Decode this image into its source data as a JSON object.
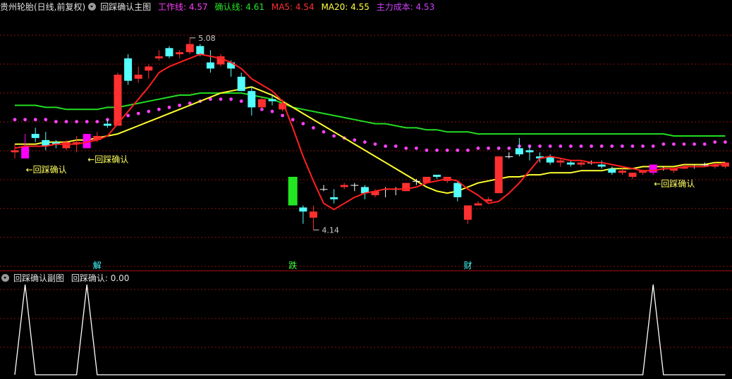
{
  "main_header": {
    "stock_title": "贵州轮胎(日线,前复权)",
    "indicator_name": "回踩确认主图",
    "legend": [
      {
        "label": "工作线: 4.57",
        "color": "#ff3cff"
      },
      {
        "label": "确认线: 4.61",
        "color": "#22e622"
      },
      {
        "label": "MA5: 4.54",
        "color": "#ff3030"
      },
      {
        "label": "MA20: 4.55",
        "color": "#ffff40"
      },
      {
        "label": "主力成本: 4.53",
        "color": "#d040ff"
      }
    ]
  },
  "sub_header": {
    "indicator_name": "回踩确认副图",
    "value_text": "回踩确认: 0.00"
  },
  "annotations": {
    "high_label": "5.08",
    "low_label": "4.14",
    "signal_label": "←回踩确认",
    "events": [
      {
        "text": "解",
        "color": "#40ffff"
      },
      {
        "text": "跌",
        "color": "#40ff40"
      },
      {
        "text": "财",
        "color": "#40ffff"
      }
    ]
  },
  "colors": {
    "background": "#000000",
    "grid": "#8b1010",
    "up_candle": "#ff3030",
    "down_candle": "#54ffff",
    "doji": "#ffffff",
    "signal_candle": "#ff00ff",
    "limit_down_candle": "#22e622",
    "ma5": "#ff2020",
    "ma20": "#ffff30",
    "confirm_line": "#22dd22",
    "work_line": "#ff40ff",
    "sub_line": "#ffffff",
    "label_white": "#cccccc",
    "label_yellow": "#ffff60"
  },
  "chart_data": [
    {
      "type": "candlestick",
      "title": "回踩确认主图",
      "ylim": [
        4.0,
        5.2
      ],
      "candles": [
        {
          "o": 4.52,
          "h": 4.56,
          "l": 4.49,
          "c": 4.53
        },
        {
          "o": 4.55,
          "h": 4.61,
          "l": 4.49,
          "c": 4.49,
          "signal": true
        },
        {
          "o": 4.61,
          "h": 4.64,
          "l": 4.57,
          "c": 4.59
        },
        {
          "o": 4.58,
          "h": 4.62,
          "l": 4.53,
          "c": 4.55
        },
        {
          "o": 4.57,
          "h": 4.58,
          "l": 4.54,
          "c": 4.56
        },
        {
          "o": 4.54,
          "h": 4.58,
          "l": 4.53,
          "c": 4.57
        },
        {
          "o": 4.56,
          "h": 4.6,
          "l": 4.52,
          "c": 4.57
        },
        {
          "o": 4.54,
          "h": 4.61,
          "l": 4.54,
          "c": 4.61,
          "signal": true
        },
        {
          "o": 4.58,
          "h": 4.62,
          "l": 4.57,
          "c": 4.6
        },
        {
          "o": 4.66,
          "h": 4.68,
          "l": 4.64,
          "c": 4.65
        },
        {
          "o": 4.65,
          "h": 4.91,
          "l": 4.65,
          "c": 4.9
        },
        {
          "o": 4.98,
          "h": 5.0,
          "l": 4.85,
          "c": 4.87
        },
        {
          "o": 4.88,
          "h": 4.94,
          "l": 4.86,
          "c": 4.9
        },
        {
          "o": 4.92,
          "h": 4.95,
          "l": 4.88,
          "c": 4.94
        },
        {
          "o": 4.98,
          "h": 5.02,
          "l": 4.97,
          "c": 4.99
        },
        {
          "o": 5.03,
          "h": 5.04,
          "l": 4.98,
          "c": 4.99
        },
        {
          "o": 5.0,
          "h": 5.02,
          "l": 4.98,
          "c": 5.01
        },
        {
          "o": 5.01,
          "h": 5.08,
          "l": 5.0,
          "c": 5.05
        },
        {
          "o": 5.04,
          "h": 5.05,
          "l": 4.99,
          "c": 5.0
        },
        {
          "o": 4.96,
          "h": 5.02,
          "l": 4.91,
          "c": 4.93
        },
        {
          "o": 4.95,
          "h": 5.0,
          "l": 4.94,
          "c": 4.99
        },
        {
          "o": 4.96,
          "h": 4.97,
          "l": 4.89,
          "c": 4.93
        },
        {
          "o": 4.89,
          "h": 4.91,
          "l": 4.82,
          "c": 4.82
        },
        {
          "o": 4.82,
          "h": 4.84,
          "l": 4.7,
          "c": 4.74
        },
        {
          "o": 4.74,
          "h": 4.79,
          "l": 4.73,
          "c": 4.78
        },
        {
          "o": 4.78,
          "h": 4.8,
          "l": 4.75,
          "c": 4.77
        },
        {
          "o": 4.73,
          "h": 4.78,
          "l": 4.72,
          "c": 4.76
        },
        {
          "o": 4.4,
          "h": 4.4,
          "l": 4.26,
          "c": 4.26,
          "limit": true
        },
        {
          "o": 4.25,
          "h": 4.26,
          "l": 4.17,
          "c": 4.23
        },
        {
          "o": 4.2,
          "h": 4.26,
          "l": 4.14,
          "c": 4.23
        },
        {
          "o": 4.34,
          "h": 4.36,
          "l": 4.33,
          "c": 4.34
        },
        {
          "o": 4.3,
          "h": 4.34,
          "l": 4.27,
          "c": 4.29
        },
        {
          "o": 4.35,
          "h": 4.37,
          "l": 4.34,
          "c": 4.36
        },
        {
          "o": 4.36,
          "h": 4.37,
          "l": 4.33,
          "c": 4.36
        },
        {
          "o": 4.35,
          "h": 4.36,
          "l": 4.29,
          "c": 4.32
        },
        {
          "o": 4.31,
          "h": 4.34,
          "l": 4.3,
          "c": 4.33
        },
        {
          "o": 4.34,
          "h": 4.35,
          "l": 4.3,
          "c": 4.34
        },
        {
          "o": 4.34,
          "h": 4.35,
          "l": 4.31,
          "c": 4.34
        },
        {
          "o": 4.33,
          "h": 4.37,
          "l": 4.33,
          "c": 4.37
        },
        {
          "o": 4.38,
          "h": 4.39,
          "l": 4.36,
          "c": 4.38
        },
        {
          "o": 4.37,
          "h": 4.4,
          "l": 4.37,
          "c": 4.4
        },
        {
          "o": 4.41,
          "h": 4.41,
          "l": 4.39,
          "c": 4.4
        },
        {
          "o": 4.38,
          "h": 4.4,
          "l": 4.37,
          "c": 4.4
        },
        {
          "o": 4.37,
          "h": 4.38,
          "l": 4.28,
          "c": 4.3
        },
        {
          "o": 4.19,
          "h": 4.26,
          "l": 4.17,
          "c": 4.26
        },
        {
          "o": 4.26,
          "h": 4.28,
          "l": 4.26,
          "c": 4.27
        },
        {
          "o": 4.28,
          "h": 4.3,
          "l": 4.28,
          "c": 4.29
        },
        {
          "o": 4.32,
          "h": 4.5,
          "l": 4.32,
          "c": 4.5
        },
        {
          "o": 4.5,
          "h": 4.52,
          "l": 4.49,
          "c": 4.5
        },
        {
          "o": 4.54,
          "h": 4.59,
          "l": 4.5,
          "c": 4.51
        },
        {
          "o": 4.53,
          "h": 4.55,
          "l": 4.48,
          "c": 4.52
        },
        {
          "o": 4.5,
          "h": 4.52,
          "l": 4.47,
          "c": 4.49
        },
        {
          "o": 4.5,
          "h": 4.51,
          "l": 4.46,
          "c": 4.47
        },
        {
          "o": 4.47,
          "h": 4.49,
          "l": 4.45,
          "c": 4.48
        },
        {
          "o": 4.47,
          "h": 4.48,
          "l": 4.45,
          "c": 4.46
        },
        {
          "o": 4.46,
          "h": 4.48,
          "l": 4.45,
          "c": 4.47
        },
        {
          "o": 4.47,
          "h": 4.48,
          "l": 4.46,
          "c": 4.47
        },
        {
          "o": 4.46,
          "h": 4.48,
          "l": 4.44,
          "c": 4.45
        },
        {
          "o": 4.44,
          "h": 4.45,
          "l": 4.41,
          "c": 4.42
        },
        {
          "o": 4.42,
          "h": 4.44,
          "l": 4.41,
          "c": 4.43
        },
        {
          "o": 4.4,
          "h": 4.42,
          "l": 4.39,
          "c": 4.42
        },
        {
          "o": 4.42,
          "h": 4.43,
          "l": 4.41,
          "c": 4.43
        },
        {
          "o": 4.42,
          "h": 4.46,
          "l": 4.41,
          "c": 4.46,
          "signal": true
        },
        {
          "o": 4.44,
          "h": 4.45,
          "l": 4.43,
          "c": 4.44
        },
        {
          "o": 4.43,
          "h": 4.44,
          "l": 4.42,
          "c": 4.44
        },
        {
          "o": 4.44,
          "h": 4.46,
          "l": 4.44,
          "c": 4.45
        },
        {
          "o": 4.45,
          "h": 4.46,
          "l": 4.44,
          "c": 4.45
        },
        {
          "o": 4.46,
          "h": 4.47,
          "l": 4.45,
          "c": 4.46
        },
        {
          "o": 4.45,
          "h": 4.47,
          "l": 4.44,
          "c": 4.46
        },
        {
          "o": 4.45,
          "h": 4.47,
          "l": 4.44,
          "c": 4.47
        }
      ],
      "series": [
        {
          "name": "MA5",
          "values": [
            4.54,
            4.55,
            4.55,
            4.55,
            4.56,
            4.56,
            4.56,
            4.57,
            4.58,
            4.6,
            4.66,
            4.72,
            4.78,
            4.84,
            4.91,
            4.94,
            4.96,
            4.98,
            5.0,
            4.99,
            4.98,
            4.96,
            4.93,
            4.88,
            4.85,
            4.82,
            4.77,
            4.64,
            4.5,
            4.38,
            4.27,
            4.24,
            4.27,
            4.3,
            4.32,
            4.33,
            4.34,
            4.34,
            4.34,
            4.35,
            4.37,
            4.38,
            4.39,
            4.38,
            4.34,
            4.31,
            4.27,
            4.28,
            4.32,
            4.37,
            4.43,
            4.49,
            4.5,
            4.49,
            4.48,
            4.48,
            4.47,
            4.47,
            4.46,
            4.45,
            4.44,
            4.43,
            4.43,
            4.44,
            4.44,
            4.45,
            4.45,
            4.45,
            4.46,
            4.46
          ]
        },
        {
          "name": "MA20",
          "values": [
            4.56,
            4.56,
            4.56,
            4.57,
            4.57,
            4.57,
            4.58,
            4.58,
            4.59,
            4.6,
            4.61,
            4.63,
            4.65,
            4.67,
            4.69,
            4.71,
            4.73,
            4.75,
            4.77,
            4.79,
            4.81,
            4.82,
            4.83,
            4.84,
            4.82,
            4.8,
            4.77,
            4.74,
            4.71,
            4.68,
            4.65,
            4.62,
            4.59,
            4.56,
            4.53,
            4.5,
            4.47,
            4.44,
            4.41,
            4.38,
            4.35,
            4.33,
            4.32,
            4.33,
            4.35,
            4.37,
            4.38,
            4.39,
            4.4,
            4.4,
            4.41,
            4.41,
            4.42,
            4.42,
            4.42,
            4.43,
            4.43,
            4.43,
            4.44,
            4.44,
            4.44,
            4.45,
            4.45,
            4.45,
            4.45,
            4.46,
            4.46,
            4.46,
            4.47,
            4.47
          ]
        },
        {
          "name": "确认线",
          "values": [
            4.75,
            4.75,
            4.75,
            4.74,
            4.74,
            4.73,
            4.73,
            4.73,
            4.73,
            4.74,
            4.74,
            4.75,
            4.76,
            4.77,
            4.78,
            4.79,
            4.8,
            4.8,
            4.81,
            4.81,
            4.81,
            4.81,
            4.81,
            4.8,
            4.79,
            4.78,
            4.76,
            4.74,
            4.73,
            4.72,
            4.71,
            4.7,
            4.69,
            4.68,
            4.67,
            4.66,
            4.66,
            4.65,
            4.64,
            4.64,
            4.63,
            4.63,
            4.62,
            4.62,
            4.62,
            4.61,
            4.61,
            4.61,
            4.61,
            4.61,
            4.61,
            4.61,
            4.61,
            4.61,
            4.61,
            4.61,
            4.61,
            4.61,
            4.61,
            4.61,
            4.61,
            4.61,
            4.61,
            4.61,
            4.6,
            4.6,
            4.6,
            4.6,
            4.6,
            4.6
          ]
        },
        {
          "name": "工作线",
          "values": [
            4.68,
            4.68,
            4.68,
            4.68,
            4.67,
            4.67,
            4.67,
            4.67,
            4.67,
            4.68,
            4.69,
            4.7,
            4.71,
            4.72,
            4.73,
            4.74,
            4.75,
            4.76,
            4.77,
            4.78,
            4.78,
            4.78,
            4.77,
            4.75,
            4.73,
            4.72,
            4.7,
            4.68,
            4.66,
            4.64,
            4.62,
            4.6,
            4.59,
            4.58,
            4.57,
            4.56,
            4.55,
            4.55,
            4.54,
            4.54,
            4.53,
            4.53,
            4.53,
            4.53,
            4.53,
            4.54,
            4.54,
            4.54,
            4.54,
            4.55,
            4.55,
            4.55,
            4.55,
            4.55,
            4.55,
            4.55,
            4.55,
            4.55,
            4.55,
            4.55,
            4.55,
            4.55,
            4.55,
            4.56,
            4.56,
            4.56,
            4.56,
            4.56,
            4.57,
            4.57
          ]
        }
      ]
    },
    {
      "type": "line",
      "title": "回踩确认副图",
      "ylim": [
        0,
        1
      ],
      "series": [
        {
          "name": "回踩确认",
          "values": [
            0,
            1,
            0,
            0,
            0,
            0,
            0,
            1,
            0,
            0,
            0,
            0,
            0,
            0,
            0,
            0,
            0,
            0,
            0,
            0,
            0,
            0,
            0,
            0,
            0,
            0,
            0,
            0,
            0,
            0,
            0,
            0,
            0,
            0,
            0,
            0,
            0,
            0,
            0,
            0,
            0,
            0,
            0,
            0,
            0,
            0,
            0,
            0,
            0,
            0,
            0,
            0,
            0,
            0,
            0,
            0,
            0,
            0,
            0,
            0,
            0,
            0,
            1,
            0,
            0,
            0,
            0,
            0,
            0,
            0
          ]
        }
      ]
    }
  ]
}
